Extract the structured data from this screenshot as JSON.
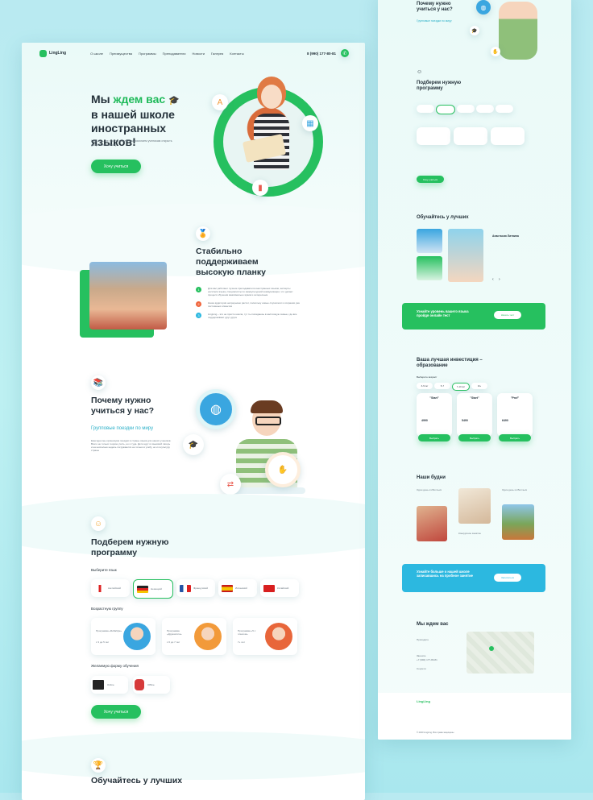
{
  "header": {
    "logo": "LingLing",
    "nav": [
      "О школе",
      "Преимущества",
      "Программы",
      "Преподаватели",
      "Новости",
      "Галерея",
      "Контакты"
    ],
    "phone": "8 (990) 177-80-81"
  },
  "hero": {
    "title_1": "Мы ",
    "title_highlight": "ждем вас",
    "title_2": "в нашей школе иностранных языков!",
    "subtitle": "LingLing – не просто школа, мы помогаем ученикам открыть дверь в новый мир",
    "cta": "Хочу учиться"
  },
  "quality": {
    "title": "Стабильно поддерживаем высокую планку",
    "points": [
      {
        "num": "1",
        "text": "Для вас работают лучшие преподаватели иностранных языков, эксперты носители языка, специалисты по межкультурной коммуникации, что делает процесс обучения максимально ярким и интересным"
      },
      {
        "num": "2",
        "text": "Наша аудитория непрерывно растет, поскольку новые слушатели и сохраняя уже постоянных клиентов"
      },
      {
        "num": "3",
        "text": "LingLing – это не просто школа, тут ты попадаешь в настоящую семью, где все поддерживают друг друга"
      }
    ]
  },
  "why": {
    "title": "Почему нужно учиться у нас?",
    "subtitle": "Групповые поездки по миру",
    "text": "Ежегодно мы организуем поездки в страны языка для наших учеников. Всего не только теорию учить, но и туда. Дети едут в языковой лагерь и на несколько недель погружаются не только в учебу, но и в культуру страны"
  },
  "program": {
    "title": "Подберем нужную программу",
    "lang_label": "Выберите язык",
    "languages": [
      "Английский",
      "Немецкий",
      "Французский",
      "Испанский",
      "Китайский"
    ],
    "age_label": "Возрастную группу",
    "ages": [
      {
        "name": "Программа «Бибабум»",
        "age": "с 3 до 5 лет"
      },
      {
        "name": "Программа «Дружилята»",
        "age": "с 6 до 7 лет"
      },
      {
        "name": "Программа «5 с плюсом»",
        "age": "7+ лет"
      }
    ],
    "form_label": "Желаемую форму обучения",
    "forms": [
      "Online",
      "Offline"
    ],
    "cta": "Хочу учиться"
  },
  "teachers": {
    "title": "Обучайтесь у лучших",
    "name": "Анастасия Литвина"
  },
  "banner_test": {
    "text": "Узнайте уровень вашего языка пройдя онлайн тест",
    "button": "Начать тест"
  },
  "pricing": {
    "title": "Ваша лучшая инвестиция – образование",
    "label": "Выберите возраст",
    "ages": [
      "3–5 лет",
      "5–7",
      "7–10 лет",
      "10+"
    ],
    "plans": [
      {
        "name": "\"Start\"",
        "price": "4990",
        "button": "Выбрать"
      },
      {
        "name": "\"Start\"",
        "price": "5490",
        "button": "Выбрать"
      },
      {
        "name": "\"Prof\"",
        "price": "6490",
        "button": "Выбрать"
      }
    ]
  },
  "gallery": {
    "title": "Наши будни",
    "items": [
      "Один день из Волчьих",
      "Конкурсное занятие",
      "Один день из Волчьих"
    ]
  },
  "banner_trial": {
    "text": "Узнайте больше о нашей школе записавшись на пробное занятие",
    "button": "Записаться"
  },
  "contacts": {
    "title": "Мы ждем вас",
    "address_label": "Приходите",
    "phone_label": "Звоните",
    "phone": "+7 (990) 177-80-81",
    "social_label": "Соцсети"
  },
  "footer": {
    "logo": "LingLing",
    "copyright": "© 2020 LingLing. Все права защищены"
  },
  "colors": {
    "accent": "#26c05f",
    "sky": "#2cb8e0",
    "bg": "#bdf0f2"
  }
}
